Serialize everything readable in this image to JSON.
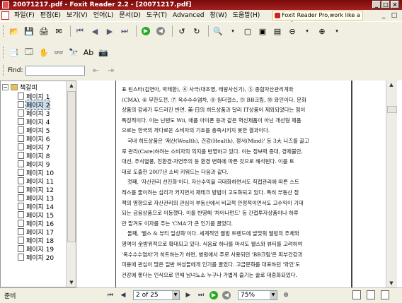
{
  "window": {
    "title": "20071217.pdf - Foxit Reader 2.2 - [20071217.pdf]",
    "buttons": {
      "minimize": "_",
      "maximize": "□",
      "close": "×"
    }
  },
  "menu": {
    "items": [
      "파일(F)",
      "편집(E)",
      "보기(V)",
      "언어(L)",
      "문서(D)",
      "도구(T)",
      "Advanced",
      "창(W)",
      "도움말(H)"
    ]
  },
  "promo_text": "Foxit Reader Pro,work like a pro!",
  "mdi_buttons": {
    "minimize": "_",
    "restore": "□",
    "close": "×"
  },
  "find": {
    "label": "Find:",
    "value": ""
  },
  "sidebar": {
    "root_label": "책갈피",
    "items": [
      "페이지 1",
      "페이지 2",
      "페이지 3",
      "페이지 4",
      "페이지 5",
      "페이지 6",
      "페이지 7",
      "페이지 8",
      "페이지 9",
      "페이지 10",
      "페이지 11",
      "페이지 12",
      "페이지 13",
      "페이지 14",
      "페이지 15",
      "페이지 16",
      "페이지 17",
      "페이지 18",
      "페이지 19",
      "페이지 20"
    ],
    "selected_index": 1
  },
  "document": {
    "lines": [
      "표 틴스타(김연아, 박태환), ④ 사극(대조영, 태왕사신기), ⑤ 종합자산관리계좌",
      "(CMA), ⑥ 무한도전, ⑦ 옥수수수염차, ⑧ 원더걸스, ⑨ BB크림, ⑩ 와인이다. 문화",
      "상품의 강세가 두드러진 반면, 美·日의 히트상품과 달리 IT상품이 제외되었다는 점이",
      "특징적이다. 이는 닌텐도 Wii, 애플 아이폰 등과 같은 혁신제품이 아닌 개선형 제품",
      "으로는 한국의 까다로운 소비자의 기호를 충족시키지 못한 결과이다.",
      "국내 히트상품은 '재산(Wealth), 건강(Health), 정서(Mind)' 등 3大 니즈를 골고",
      "루 관리(Care)하려는 소비자의 의지를 반영하고 있다. 이는 정보력 증대, 경제불안,",
      "대선, 주식열풍, 친환경·자연주의 등 환경 변화에 따른 것으로 해석된다. 이를 토",
      "대로 도출한 2007년 소비 키워드는 다음과 같다.",
      "첫째, '자산관리 선진화'이다. 자산수익을 극대화하면서도 직접관리에 따른 스트",
      "레스를 줄이려는 심리가 커지면서 재테크 방법이 고도화되고 있다. 특히 부동산 정",
      "책의 영향으로 자산관리의 관심이 부동산에서 비교적 안정적이면서도 고수익이 기대",
      "되는 금융상품으로 이동했다. 이를 반영해 '차이나펀드' 등 간접투자상품이나 하루",
      "만 맡겨도 이자를 주는 'CMA'가 큰 인기를 끌었다.",
      "둘째, '웰스 & 뷰티 일상화'이다. 세계적인 웰빙 트렌드에 발맞춰 웰빙의 주체와",
      "영역이 全방위적으로 확대되고 있다. 식음료 하나를 마셔도 웰스와 뷰티를 고려하여",
      "'옥수수수염차'가 히트하는가 하면, 병원에서 주로 사용되던 'BB크림'은 피부건강과",
      "미용에 관심이 많은 일반 여성들에게 인기를 끌었다. 고급문화를 대표하던 '와인'도",
      "건강에 좋다는 인식으로 인해 남녀노소 누구나 가볍게 즐기는 술로 대중화되었다."
    ]
  },
  "status": {
    "ready": "준비",
    "page_field": "2 of 25",
    "zoom": "75%"
  }
}
